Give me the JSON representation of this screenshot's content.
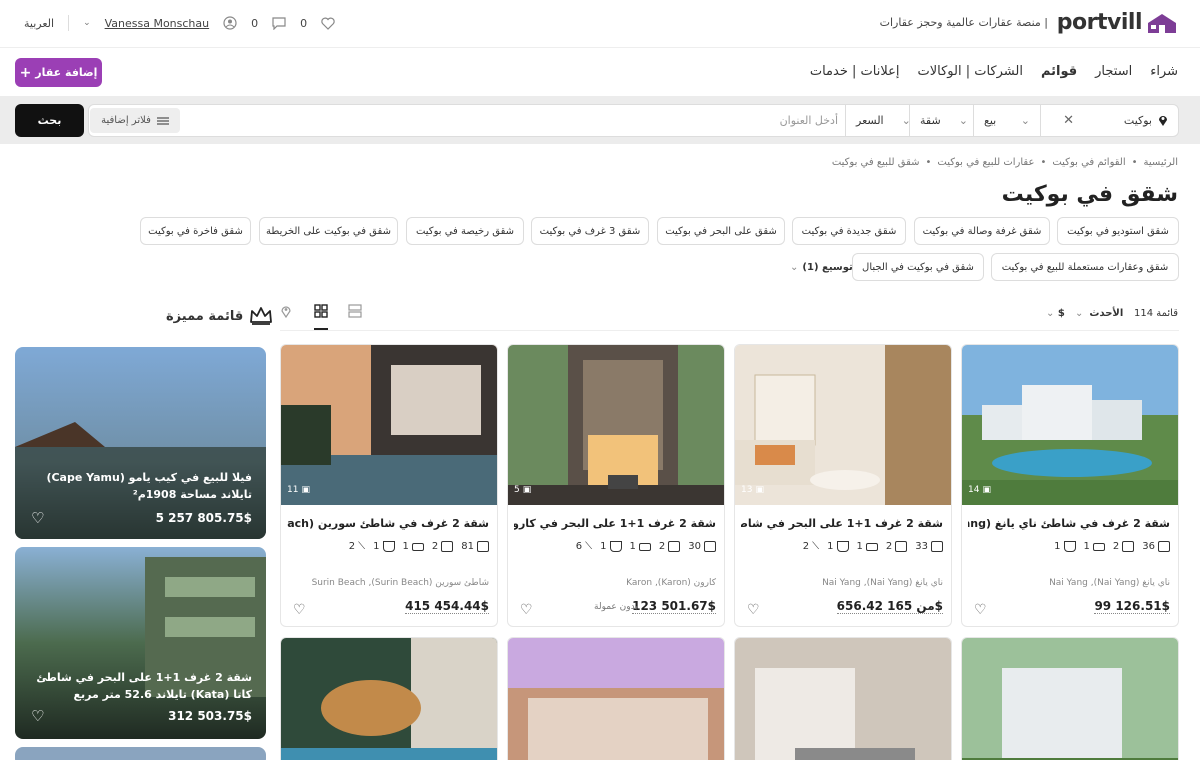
{
  "header": {
    "logo": "portvill",
    "tagline": "منصة عقارات عالمية وحجز عقارات |",
    "language": "العربية",
    "user_name": "Vanessa Monschau",
    "messages_count": "0",
    "favorites_count": "0"
  },
  "nav": {
    "items": [
      "شراء",
      "استجار",
      "قوائم",
      "الشركات | الوكالات",
      "إعلانات | خدمات"
    ],
    "add_property": "إضافة عقار"
  },
  "search": {
    "location": "بوكيت",
    "type": "بيع",
    "category": "شقة",
    "price": "السعر",
    "address_placeholder": "أدخل العنوان",
    "filters": "فلاتر إضافية",
    "submit": "بحث"
  },
  "breadcrumbs": [
    "الرئيسية",
    "القوائم في بوكيت",
    "عقارات للبيع في بوكيت",
    "شقق للبيع في بوكيت"
  ],
  "page_title": "شقق في بوكيت",
  "chips": [
    "شقق استوديو في بوكيت",
    "شقق غرفة وصالة في بوكيت",
    "شقق جديدة في بوكيت",
    "شقق على البحر في بوكيت",
    "شقق 3 غرف في بوكيت",
    "شقق رخيصة في بوكيت",
    "شقق في بوكيت على الخريطة",
    "شقق فاخرة في بوكيت",
    "شقق وعقارات مستعملة للبيع في بوكيت",
    "شقق في بوكيت في الجبال"
  ],
  "expand": "توسيع (1)",
  "results": {
    "count": "114 قائمة",
    "sort": "الأحدث",
    "currency": "$",
    "featured_title": "قائمة مميزة"
  },
  "listings": [
    {
      "photos": "14",
      "title": "شقة 2 غرف في شاطئ ناي يانغ (Nai Yang",
      "size": "36",
      "beds": "2",
      "baths": "1",
      "floor": "1",
      "extra": "",
      "location": "ناي يانغ (Nai Yang), Nai Yang",
      "price": "99 126.51$",
      "prefix": "",
      "note": ""
    },
    {
      "photos": "13",
      "title": "شقة 2 غرف 1+1 على البحر في شاطئ ناي",
      "size": "33",
      "beds": "2",
      "baths": "1",
      "floor": "1",
      "extra": "2",
      "location": "ناي يانغ (Nai Yang), Nai Yang",
      "price": "165 656.42$",
      "prefix": "من",
      "note": ""
    },
    {
      "photos": "5",
      "title": "شقة 2 غرف 1+1 على البحر في كارون (Karon",
      "size": "30",
      "beds": "2",
      "baths": "1",
      "floor": "1",
      "extra": "6",
      "location": "كارون (Karon), Karon",
      "price": "123 501.67$",
      "prefix": "",
      "note": "بدون عمولة"
    },
    {
      "photos": "11",
      "title": "شقة 2 غرف في شاطئ سورين (Surin Beach",
      "size": "81",
      "beds": "2",
      "baths": "1",
      "floor": "1",
      "extra": "2",
      "location": "شاطئ سورين (Surin Beach), Surin Beach",
      "price": "415 454.44$",
      "prefix": "",
      "note": ""
    }
  ],
  "featured": [
    {
      "title": "فيلا للبيع في كيب يامو (Cape Yamu) تايلاند مساحة 1908م²",
      "price": "5 257 805.75$"
    },
    {
      "title": "شقة 2 غرف 1+1 على البحر في شاطئ كاتا (Kata) تايلاند 52.6 متر مربع",
      "price": "312 503.75$"
    }
  ]
}
